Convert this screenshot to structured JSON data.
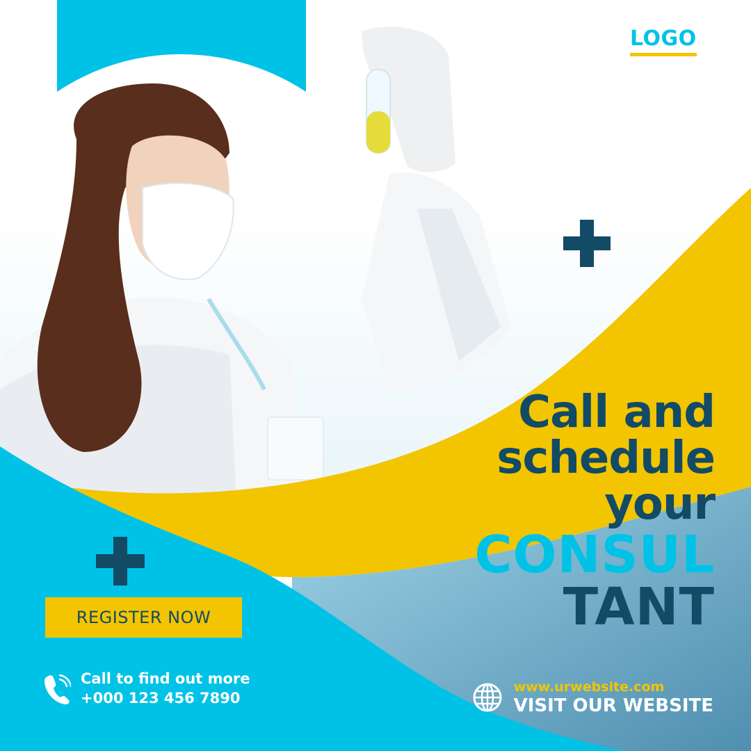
{
  "logo": {
    "text": "LOGO"
  },
  "headline": {
    "line1": "Call and",
    "line2": "schedule",
    "line3": "your",
    "line4": "CONSUL",
    "line5": "TANT"
  },
  "cta": {
    "register_label": "REGISTER NOW"
  },
  "contact": {
    "call_label": "Call to find out more",
    "phone": "+000 123 456 7890",
    "phone_icon": "phone-icon"
  },
  "website": {
    "url": "www.urwebsite.com",
    "visit_label": "VISIT OUR WEBSITE",
    "globe_icon": "globe-icon"
  },
  "colors": {
    "cyan": "#00c2e6",
    "yellow": "#f2c500",
    "navy": "#134a66",
    "white": "#ffffff"
  }
}
